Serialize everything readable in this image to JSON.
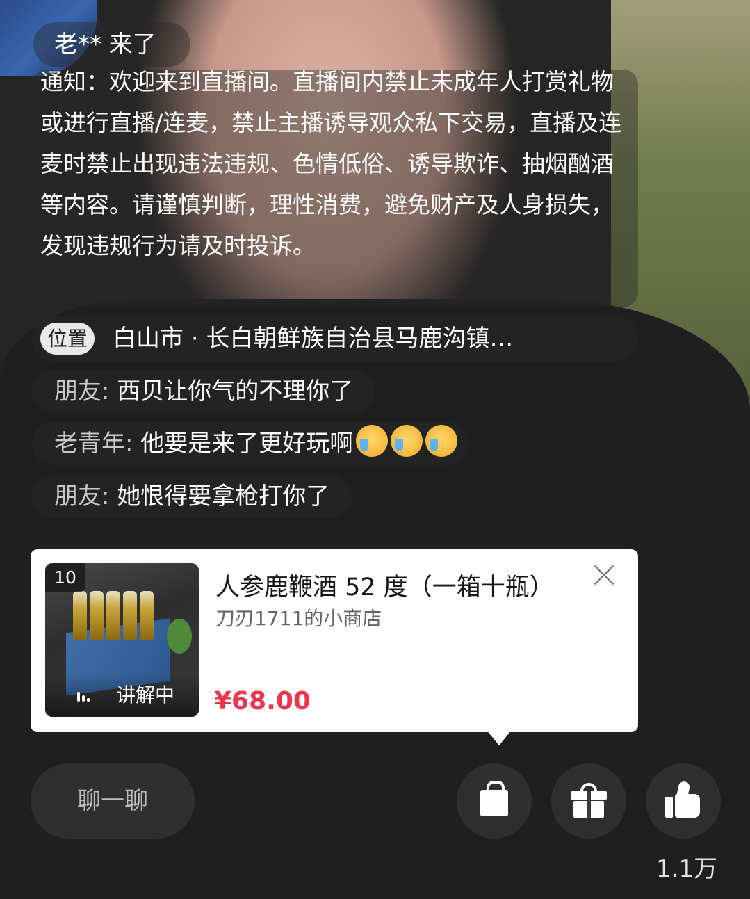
{
  "entry": {
    "text": "老** 来了"
  },
  "notice": {
    "text": "通知：欢迎来到直播间。直播间内禁止未成年人打赏礼物或进行直播/连麦，禁止主播诱导观众私下交易，直播及连麦时禁止出现违法违规、色情低俗、诱导欺诈、抽烟酗酒等内容。请谨慎判断，理性消费，避免财产及人身损失，发现违规行为请及时投诉。"
  },
  "location": {
    "tag": "位置",
    "text": "白山市 · 长白朝鲜族自治县马鹿沟镇…"
  },
  "comments": [
    {
      "user": "朋友",
      "message": "西贝让你气的不理你了"
    },
    {
      "user": "老青年",
      "message": "他要是来了更好玩啊",
      "emoji": "crying-laughing-face-icon"
    },
    {
      "user": "朋友",
      "message": "她恨得要拿枪打你了"
    }
  ],
  "product": {
    "index": "10",
    "status": "讲解中",
    "title": "人参鹿鞭酒 52 度（一箱十瓶）",
    "shop": "刀刃1711的小商店",
    "price": "¥68.00",
    "price_color": "#f0334b"
  },
  "bottom_bar": {
    "chat_placeholder": "聊一聊",
    "like_count": "1.1万"
  }
}
